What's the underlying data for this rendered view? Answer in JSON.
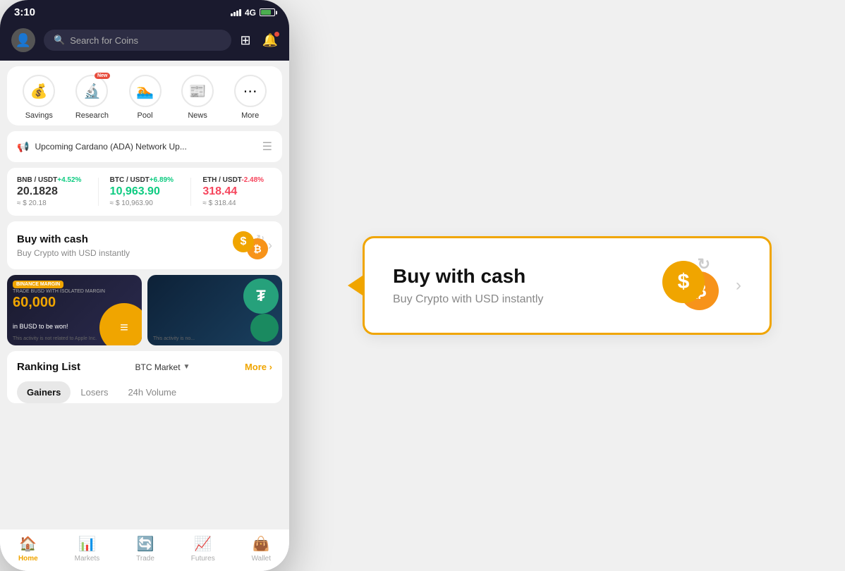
{
  "status": {
    "time": "3:10",
    "network": "4G"
  },
  "search": {
    "placeholder": "Search for Coins"
  },
  "quickActions": {
    "items": [
      {
        "id": "savings",
        "label": "Savings",
        "icon": "💰",
        "isNew": false
      },
      {
        "id": "research",
        "label": "Research",
        "icon": "🔬",
        "isNew": true
      },
      {
        "id": "pool",
        "label": "Pool",
        "icon": "🏊",
        "isNew": false
      },
      {
        "id": "news",
        "label": "News",
        "icon": "📰",
        "isNew": false
      },
      {
        "id": "more",
        "label": "More",
        "icon": "⋯",
        "isNew": false
      }
    ]
  },
  "announcement": {
    "text": "Upcoming Cardano (ADA) Network Up..."
  },
  "tickers": [
    {
      "pair": "BNB / USDT",
      "change": "+4.52%",
      "positive": true,
      "price": "20.1828",
      "usd": "≈ $ 20.18"
    },
    {
      "pair": "BTC / USDT",
      "change": "+6.89%",
      "positive": true,
      "price": "10,963.90",
      "usd": "≈ $ 10,963.90"
    },
    {
      "pair": "ETH / USDT",
      "change": "-2.48%",
      "positive": false,
      "price": "318.44",
      "usd": "≈ $ 318.44"
    }
  ],
  "buyCash": {
    "title": "Buy with cash",
    "subtitle": "Buy Crypto with USD instantly"
  },
  "banner1": {
    "label": "BINANCE MARGIN",
    "subtitle": "TRADE BUSD WITH ISOLATED MARGIN",
    "amount": "60,000",
    "unit": "in BUSD to be won!",
    "disclaimer": "This activity is not related to Apple Inc."
  },
  "banner2": {
    "disclaimer": "This activity is no..."
  },
  "ranking": {
    "title": "Ranking List",
    "filter": "BTC Market",
    "more": "More",
    "tabs": [
      {
        "id": "gainers",
        "label": "Gainers",
        "active": true
      },
      {
        "id": "losers",
        "label": "Losers",
        "active": false
      },
      {
        "id": "volume",
        "label": "24h Volume",
        "active": false
      }
    ]
  },
  "bottomNav": {
    "items": [
      {
        "id": "home",
        "label": "Home",
        "icon": "🏠",
        "active": true
      },
      {
        "id": "markets",
        "label": "Markets",
        "icon": "📊",
        "active": false
      },
      {
        "id": "trade",
        "label": "Trade",
        "icon": "🔄",
        "active": false
      },
      {
        "id": "futures",
        "label": "Futures",
        "icon": "📈",
        "active": false
      },
      {
        "id": "wallet",
        "label": "Wallet",
        "icon": "👜",
        "active": false
      }
    ]
  },
  "expandedCard": {
    "title": "Buy with cash",
    "subtitle": "Buy Crypto with USD instantly"
  }
}
